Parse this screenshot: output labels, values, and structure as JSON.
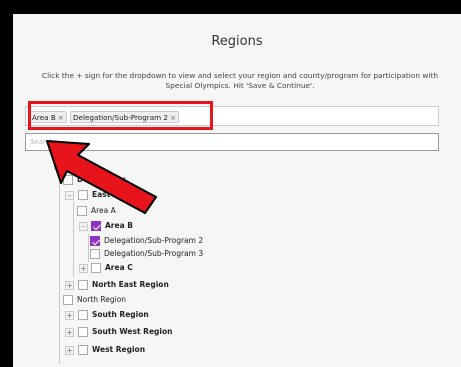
{
  "page": {
    "title": "Regions",
    "instructions": "Click the + sign for the dropdown to view and select your region and county/program for participation with Special Olympics. Hit 'Save & Continue'."
  },
  "selected_tags": [
    {
      "label": "Area B",
      "remove": "×"
    },
    {
      "label": "Delegation/Sub-Program 2",
      "remove": "×"
    }
  ],
  "search": {
    "placeholder": "Search",
    "value": ""
  },
  "tree": {
    "root_toggle": "+",
    "root_label": "CO",
    "items": [
      {
        "label": "Don't Know"
      },
      {
        "toggle": "-",
        "label": "East Region"
      },
      {
        "label": "Area A"
      },
      {
        "toggle": "-",
        "label": "Area B",
        "checked": true
      },
      {
        "label": "Delegation/Sub-Program 2",
        "checked": true
      },
      {
        "label": "Delegation/Sub-Program 3"
      },
      {
        "toggle": "+",
        "label": "Area C"
      },
      {
        "toggle": "+",
        "label": "North East Region"
      },
      {
        "label": "North Region"
      },
      {
        "toggle": "+",
        "label": "South Region"
      },
      {
        "toggle": "+",
        "label": "South West Region"
      },
      {
        "toggle": "+",
        "label": "West Region"
      }
    ]
  },
  "colors": {
    "highlight": "#e8141b",
    "checkbox_checked": "#8e35c7",
    "arrow_fill": "#e8141b"
  }
}
